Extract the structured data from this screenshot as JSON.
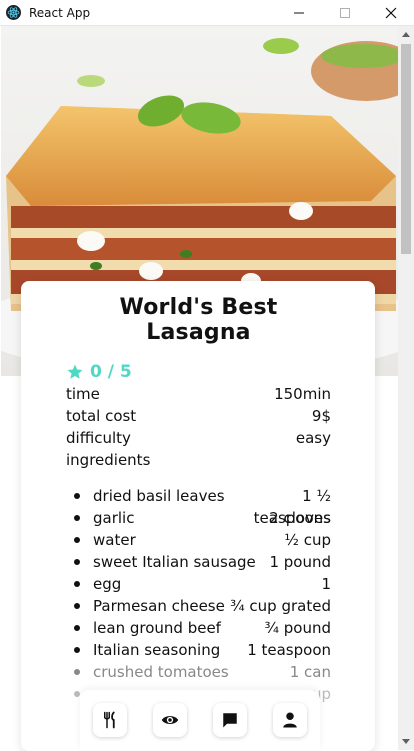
{
  "window": {
    "title": "React App",
    "controls": [
      "minimize-icon",
      "maximize-icon",
      "close-icon"
    ]
  },
  "recipe": {
    "title": "World's Best Lasagna",
    "rating": "0 / 5",
    "details": [
      {
        "label": "time",
        "value": "150min"
      },
      {
        "label": "total cost",
        "value": "9$"
      },
      {
        "label": "difficulty",
        "value": "easy"
      }
    ],
    "ingredients_label": "ingredients",
    "ingredients": [
      {
        "name": "dried basil leaves",
        "qty": "1 ½ teaspoons"
      },
      {
        "name": "garlic",
        "qty": "2 cloves"
      },
      {
        "name": "water",
        "qty": "½ cup"
      },
      {
        "name": "sweet Italian sausage",
        "qty": "1 pound"
      },
      {
        "name": "egg",
        "qty": "1"
      },
      {
        "name": "Parmesan cheese",
        "qty": "¾ cup grated"
      },
      {
        "name": "lean ground beef",
        "qty": "¾ pound"
      },
      {
        "name": "Italian seasoning",
        "qty": "1 teaspoon"
      },
      {
        "name": "crushed tomatoes",
        "qty": "1 can"
      },
      {
        "name": "",
        "qty": "up"
      }
    ]
  },
  "bottom_nav": {
    "items": [
      "utensils-icon",
      "eye-icon",
      "comment-icon",
      "user-icon"
    ]
  },
  "colors": {
    "accent": "#4fd8c4",
    "text": "#111111"
  }
}
